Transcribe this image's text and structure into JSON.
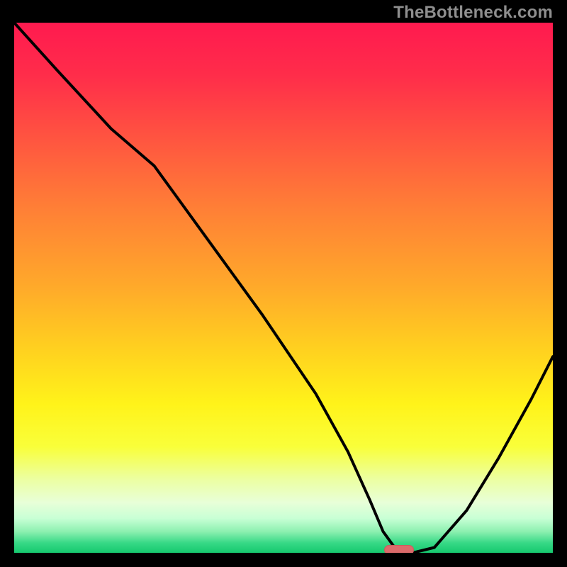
{
  "watermark": "TheBottleneck.com",
  "colors": {
    "black": "#000000",
    "curve": "#000000",
    "marker_fill": "#db6b6b",
    "marker_stroke": "#c85d5d",
    "gradient_stops": [
      {
        "offset": 0.0,
        "color": "#ff1a4f"
      },
      {
        "offset": 0.1,
        "color": "#ff2d4a"
      },
      {
        "offset": 0.22,
        "color": "#ff5540"
      },
      {
        "offset": 0.35,
        "color": "#ff7f36"
      },
      {
        "offset": 0.5,
        "color": "#ffaa2a"
      },
      {
        "offset": 0.62,
        "color": "#ffd21f"
      },
      {
        "offset": 0.72,
        "color": "#fff31a"
      },
      {
        "offset": 0.8,
        "color": "#f9ff3a"
      },
      {
        "offset": 0.86,
        "color": "#ecffa0"
      },
      {
        "offset": 0.905,
        "color": "#e8ffd8"
      },
      {
        "offset": 0.935,
        "color": "#c8ffd5"
      },
      {
        "offset": 0.96,
        "color": "#8cf0b0"
      },
      {
        "offset": 0.982,
        "color": "#35d885"
      },
      {
        "offset": 1.0,
        "color": "#16c96f"
      }
    ]
  },
  "chart_data": {
    "type": "line",
    "title": "",
    "xlabel": "",
    "ylabel": "",
    "xlim": [
      0,
      100
    ],
    "ylim": [
      0,
      100
    ],
    "x": [
      0,
      8,
      18,
      26,
      36,
      46,
      56,
      62,
      66,
      68.5,
      71,
      74,
      78,
      84,
      90,
      96,
      100
    ],
    "values": [
      100,
      91,
      80,
      73,
      59,
      45,
      30,
      19,
      10,
      4,
      0.5,
      0,
      1,
      8,
      18,
      29,
      37
    ],
    "marker": {
      "x": 71.5,
      "y": 0.6
    },
    "note": "Values estimated from pixel positions; y=0 is bottom (green zone), y=100 is top (red zone)."
  }
}
